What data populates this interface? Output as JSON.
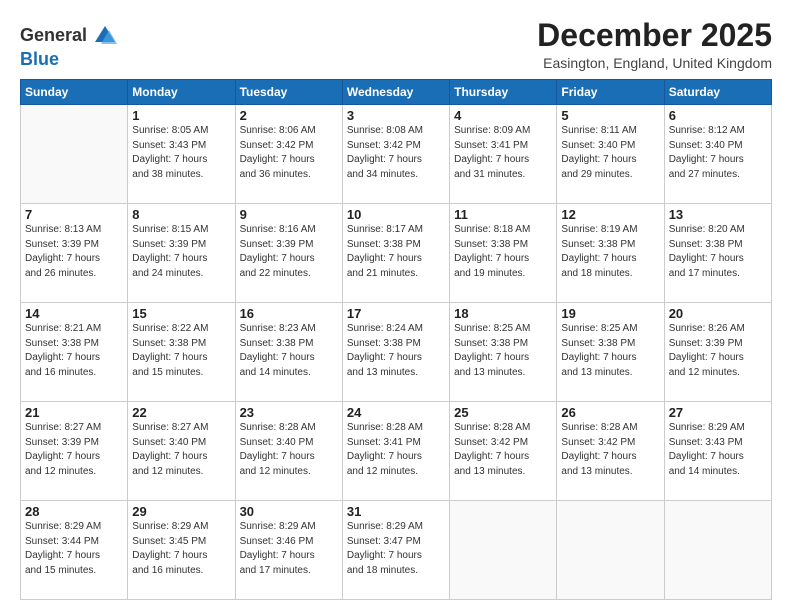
{
  "header": {
    "logo_line1": "General",
    "logo_line2": "Blue",
    "month": "December 2025",
    "location": "Easington, England, United Kingdom"
  },
  "weekdays": [
    "Sunday",
    "Monday",
    "Tuesday",
    "Wednesday",
    "Thursday",
    "Friday",
    "Saturday"
  ],
  "weeks": [
    [
      {
        "day": "",
        "info": ""
      },
      {
        "day": "1",
        "info": "Sunrise: 8:05 AM\nSunset: 3:43 PM\nDaylight: 7 hours\nand 38 minutes."
      },
      {
        "day": "2",
        "info": "Sunrise: 8:06 AM\nSunset: 3:42 PM\nDaylight: 7 hours\nand 36 minutes."
      },
      {
        "day": "3",
        "info": "Sunrise: 8:08 AM\nSunset: 3:42 PM\nDaylight: 7 hours\nand 34 minutes."
      },
      {
        "day": "4",
        "info": "Sunrise: 8:09 AM\nSunset: 3:41 PM\nDaylight: 7 hours\nand 31 minutes."
      },
      {
        "day": "5",
        "info": "Sunrise: 8:11 AM\nSunset: 3:40 PM\nDaylight: 7 hours\nand 29 minutes."
      },
      {
        "day": "6",
        "info": "Sunrise: 8:12 AM\nSunset: 3:40 PM\nDaylight: 7 hours\nand 27 minutes."
      }
    ],
    [
      {
        "day": "7",
        "info": "Sunrise: 8:13 AM\nSunset: 3:39 PM\nDaylight: 7 hours\nand 26 minutes."
      },
      {
        "day": "8",
        "info": "Sunrise: 8:15 AM\nSunset: 3:39 PM\nDaylight: 7 hours\nand 24 minutes."
      },
      {
        "day": "9",
        "info": "Sunrise: 8:16 AM\nSunset: 3:39 PM\nDaylight: 7 hours\nand 22 minutes."
      },
      {
        "day": "10",
        "info": "Sunrise: 8:17 AM\nSunset: 3:38 PM\nDaylight: 7 hours\nand 21 minutes."
      },
      {
        "day": "11",
        "info": "Sunrise: 8:18 AM\nSunset: 3:38 PM\nDaylight: 7 hours\nand 19 minutes."
      },
      {
        "day": "12",
        "info": "Sunrise: 8:19 AM\nSunset: 3:38 PM\nDaylight: 7 hours\nand 18 minutes."
      },
      {
        "day": "13",
        "info": "Sunrise: 8:20 AM\nSunset: 3:38 PM\nDaylight: 7 hours\nand 17 minutes."
      }
    ],
    [
      {
        "day": "14",
        "info": "Sunrise: 8:21 AM\nSunset: 3:38 PM\nDaylight: 7 hours\nand 16 minutes."
      },
      {
        "day": "15",
        "info": "Sunrise: 8:22 AM\nSunset: 3:38 PM\nDaylight: 7 hours\nand 15 minutes."
      },
      {
        "day": "16",
        "info": "Sunrise: 8:23 AM\nSunset: 3:38 PM\nDaylight: 7 hours\nand 14 minutes."
      },
      {
        "day": "17",
        "info": "Sunrise: 8:24 AM\nSunset: 3:38 PM\nDaylight: 7 hours\nand 13 minutes."
      },
      {
        "day": "18",
        "info": "Sunrise: 8:25 AM\nSunset: 3:38 PM\nDaylight: 7 hours\nand 13 minutes."
      },
      {
        "day": "19",
        "info": "Sunrise: 8:25 AM\nSunset: 3:38 PM\nDaylight: 7 hours\nand 13 minutes."
      },
      {
        "day": "20",
        "info": "Sunrise: 8:26 AM\nSunset: 3:39 PM\nDaylight: 7 hours\nand 12 minutes."
      }
    ],
    [
      {
        "day": "21",
        "info": "Sunrise: 8:27 AM\nSunset: 3:39 PM\nDaylight: 7 hours\nand 12 minutes."
      },
      {
        "day": "22",
        "info": "Sunrise: 8:27 AM\nSunset: 3:40 PM\nDaylight: 7 hours\nand 12 minutes."
      },
      {
        "day": "23",
        "info": "Sunrise: 8:28 AM\nSunset: 3:40 PM\nDaylight: 7 hours\nand 12 minutes."
      },
      {
        "day": "24",
        "info": "Sunrise: 8:28 AM\nSunset: 3:41 PM\nDaylight: 7 hours\nand 12 minutes."
      },
      {
        "day": "25",
        "info": "Sunrise: 8:28 AM\nSunset: 3:42 PM\nDaylight: 7 hours\nand 13 minutes."
      },
      {
        "day": "26",
        "info": "Sunrise: 8:28 AM\nSunset: 3:42 PM\nDaylight: 7 hours\nand 13 minutes."
      },
      {
        "day": "27",
        "info": "Sunrise: 8:29 AM\nSunset: 3:43 PM\nDaylight: 7 hours\nand 14 minutes."
      }
    ],
    [
      {
        "day": "28",
        "info": "Sunrise: 8:29 AM\nSunset: 3:44 PM\nDaylight: 7 hours\nand 15 minutes."
      },
      {
        "day": "29",
        "info": "Sunrise: 8:29 AM\nSunset: 3:45 PM\nDaylight: 7 hours\nand 16 minutes."
      },
      {
        "day": "30",
        "info": "Sunrise: 8:29 AM\nSunset: 3:46 PM\nDaylight: 7 hours\nand 17 minutes."
      },
      {
        "day": "31",
        "info": "Sunrise: 8:29 AM\nSunset: 3:47 PM\nDaylight: 7 hours\nand 18 minutes."
      },
      {
        "day": "",
        "info": ""
      },
      {
        "day": "",
        "info": ""
      },
      {
        "day": "",
        "info": ""
      }
    ]
  ]
}
